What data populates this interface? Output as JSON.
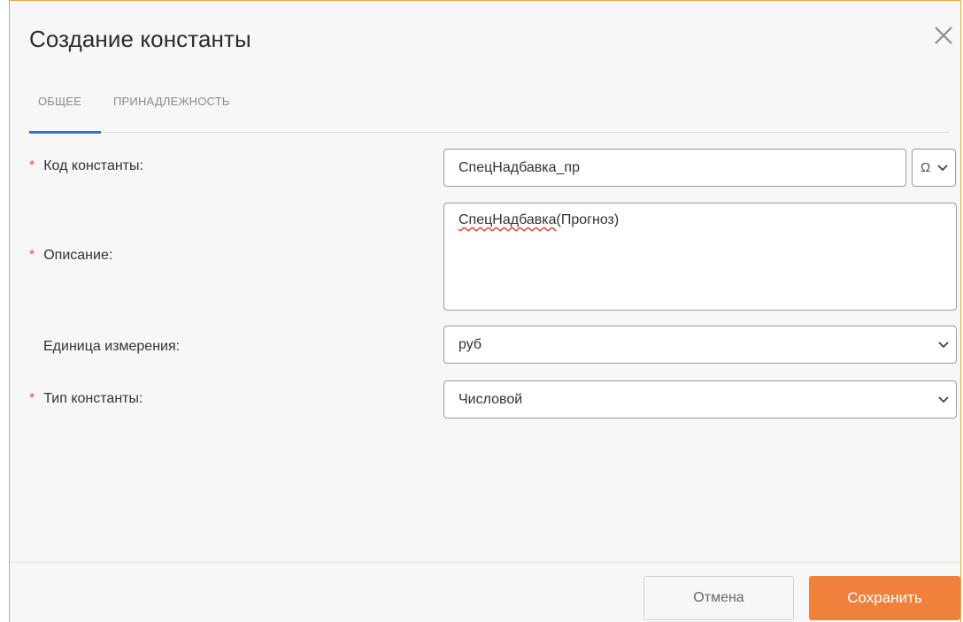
{
  "dialog": {
    "title": "Создание константы"
  },
  "tabs": [
    {
      "label": "ОБЩЕЕ",
      "active": true
    },
    {
      "label": "ПРИНАДЛЕЖНОСТЬ",
      "active": false
    }
  ],
  "form": {
    "required_mark": "*",
    "code": {
      "label": "Код константы:",
      "value": "СпецНадбавка_пр",
      "required": true,
      "special_chars_button": "Ω"
    },
    "description": {
      "label": "Описание:",
      "value_underlined": "СпецНадбавка",
      "value_rest": "(Прогноз)",
      "required": true
    },
    "unit": {
      "label": "Единица измерения:",
      "value": "руб",
      "required": false
    },
    "type": {
      "label": "Тип константы:",
      "value": "Числовой",
      "required": true
    }
  },
  "footer": {
    "cancel_label": "Отмена",
    "save_label": "Сохранить"
  },
  "colors": {
    "accent": "#f0813d",
    "tab_underline": "#2f6fd6",
    "required": "#e2523d"
  }
}
